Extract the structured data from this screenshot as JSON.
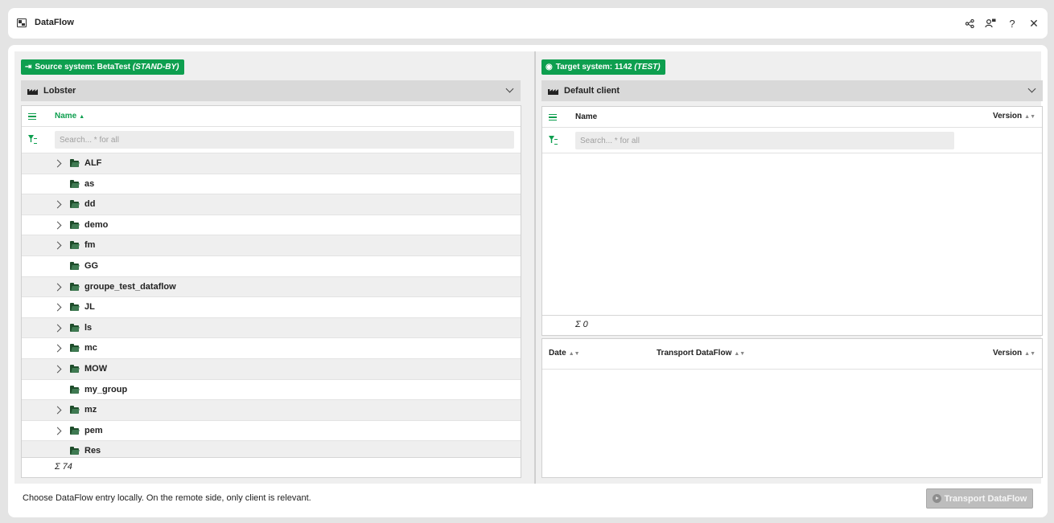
{
  "window": {
    "title": "DataFlow"
  },
  "toolbar": {
    "share_icon": "share-icon",
    "users_icon": "user-group-icon",
    "help_label": "?",
    "close_label": "✕"
  },
  "source": {
    "badge_prefix": "Source system: BetaTest ",
    "badge_mode": "(STAND-BY)",
    "client": "Lobster",
    "column_name": "Name",
    "search_placeholder": "Search... * for all",
    "items": [
      {
        "label": "ALF",
        "expandable": true
      },
      {
        "label": "as",
        "expandable": false
      },
      {
        "label": "dd",
        "expandable": true
      },
      {
        "label": "demo",
        "expandable": true
      },
      {
        "label": "fm",
        "expandable": true
      },
      {
        "label": "GG",
        "expandable": false
      },
      {
        "label": "groupe_test_dataflow",
        "expandable": true
      },
      {
        "label": "JL",
        "expandable": true
      },
      {
        "label": "ls",
        "expandable": true
      },
      {
        "label": "mc",
        "expandable": true
      },
      {
        "label": "MOW",
        "expandable": true
      },
      {
        "label": "my_group",
        "expandable": false
      },
      {
        "label": "mz",
        "expandable": true
      },
      {
        "label": "pem",
        "expandable": true
      },
      {
        "label": "Res",
        "expandable": false
      }
    ],
    "sum": "Σ 74"
  },
  "target": {
    "badge_prefix": "Target system: 1142 ",
    "badge_mode": "(TEST)",
    "client": "Default client",
    "column_name": "Name",
    "column_version": "Version",
    "search_placeholder": "Search... * for all",
    "sum": "Σ 0",
    "history": {
      "col_date": "Date",
      "col_transport": "Transport DataFlow",
      "col_version": "Version"
    }
  },
  "status_text": "Choose DataFlow entry locally. On the remote side, only client is relevant.",
  "transport_button": "Transport DataFlow",
  "colors": {
    "accent": "#0e9f4f",
    "row_alt": "#efefef",
    "disabled_button": "#bdbdbd"
  }
}
